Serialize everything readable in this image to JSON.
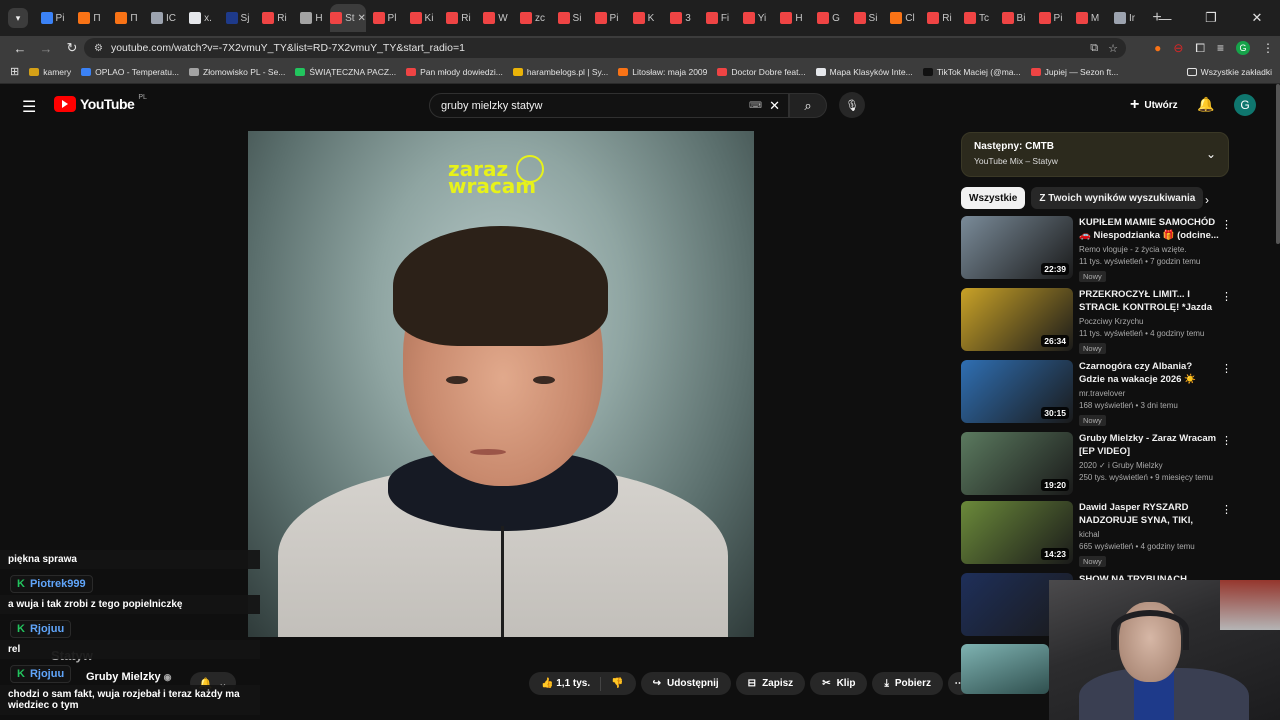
{
  "browser": {
    "tabs": [
      {
        "label": "Pi",
        "color": "#3b82f6"
      },
      {
        "label": "П",
        "color": "#f97316"
      },
      {
        "label": "П",
        "color": "#f97316"
      },
      {
        "label": "IC",
        "color": "#9ca3af"
      },
      {
        "label": "x.",
        "color": "#e5e7eb"
      },
      {
        "label": "Sj",
        "color": "#1e3a8a"
      },
      {
        "label": "Ri",
        "color": "#ef4444"
      },
      {
        "label": "H",
        "color": "#a3a3a3"
      },
      {
        "label": "St",
        "color": "#ef4444",
        "active": true
      },
      {
        "label": "Pl",
        "color": "#ef4444"
      },
      {
        "label": "Ki",
        "color": "#ef4444"
      },
      {
        "label": "Ri",
        "color": "#ef4444"
      },
      {
        "label": "W",
        "color": "#ef4444"
      },
      {
        "label": "zc",
        "color": "#ef4444"
      },
      {
        "label": "Si",
        "color": "#ef4444"
      },
      {
        "label": "Pi",
        "color": "#ef4444"
      },
      {
        "label": "K",
        "color": "#ef4444"
      },
      {
        "label": "3",
        "color": "#ef4444"
      },
      {
        "label": "Fi",
        "color": "#ef4444"
      },
      {
        "label": "Yi",
        "color": "#ef4444"
      },
      {
        "label": "H",
        "color": "#ef4444"
      },
      {
        "label": "G",
        "color": "#ef4444"
      },
      {
        "label": "Si",
        "color": "#ef4444"
      },
      {
        "label": "Cl",
        "color": "#f97316"
      },
      {
        "label": "Ri",
        "color": "#ef4444"
      },
      {
        "label": "Tc",
        "color": "#ef4444"
      },
      {
        "label": "Bi",
        "color": "#ef4444"
      },
      {
        "label": "Pi",
        "color": "#ef4444"
      },
      {
        "label": "M",
        "color": "#ef4444"
      },
      {
        "label": "Ir",
        "color": "#9ca3af"
      }
    ],
    "url": "youtube.com/watch?v=-7X2vmuY_TY&list=RD-7X2vmuY_TY&start_radio=1",
    "bookmarks": [
      {
        "label": "kamery",
        "color": "#d4a017"
      },
      {
        "label": "OPLAO - Temperatu...",
        "color": "#3b82f6"
      },
      {
        "label": "Złomowisko PL - Se...",
        "color": "#a3a3a3"
      },
      {
        "label": "ŚWIĄTECZNA PACZ...",
        "color": "#22c55e"
      },
      {
        "label": "Pan młody dowiedzi...",
        "color": "#ef4444"
      },
      {
        "label": "harambelogs.pl | Sy...",
        "color": "#eab308"
      },
      {
        "label": "Litosław: maja 2009",
        "color": "#f97316"
      },
      {
        "label": "Doctor Dobre feat...",
        "color": "#ef4444"
      },
      {
        "label": "Mapa Klasyków Inte...",
        "color": "#e5e7eb"
      },
      {
        "label": "TikTok Maciej (@ma...",
        "color": "#111111"
      },
      {
        "label": "Jupiej — Sezon ft...",
        "color": "#ef4444"
      }
    ],
    "bookmarks_all": "Wszystkie zakładki"
  },
  "youtube": {
    "logo_text": "YouTube",
    "region": "PL",
    "search_value": "gruby mielzky statyw",
    "create_label": "Utwórz",
    "avatar_letter": "G"
  },
  "video": {
    "overlay_text_line1": "zaraz",
    "overlay_text_line2": "wracam",
    "title": "Statyw",
    "channel": "Gruby Mielzky",
    "actions": {
      "likes": "1,1 tys.",
      "share": "Udostępnij",
      "save": "Zapisz",
      "clip": "Klip",
      "download": "Pobierz"
    }
  },
  "chat": [
    {
      "type": "msg",
      "text": "piękna sprawa"
    },
    {
      "type": "user",
      "name": "Piotrek999"
    },
    {
      "type": "msg",
      "text": "a wuja i tak zrobi z tego popielniczkę"
    },
    {
      "type": "user",
      "name": "Rjojuu"
    },
    {
      "type": "msg",
      "text": "rel"
    },
    {
      "type": "user",
      "name": "Rjojuu"
    },
    {
      "type": "msg",
      "text": "chodzi o sam fakt, wuja rozjebał i teraz każdy ma wiedziec o tym"
    }
  ],
  "sidebar": {
    "next_label": "Następny: CMTB",
    "next_sub": "YouTube Mix – Statyw",
    "chips": [
      "Wszystkie",
      "Z Twoich wyników wyszukiwania"
    ],
    "recommendations": [
      {
        "title": "KUPIŁEM MAMIE SAMOCHÓD 🚗 Niespodzianka 🎁 (odcine...",
        "channel": "Remo vloguje - z życia wzięte.",
        "meta": "11 tys. wyświetleń • 7 godzin temu",
        "duration": "22:39",
        "badge": "Nowy",
        "thumb": "#7a8b99"
      },
      {
        "title": "PRZEKROCZYŁ LIMIT... I STRACIŁ KONTROLĘ! *Jazda ...",
        "channel": "Poczciwy Krzychu",
        "meta": "11 tys. wyświetleń • 4 godziny temu",
        "duration": "26:34",
        "badge": "Nowy",
        "thumb": "#c9a227"
      },
      {
        "title": "Czarnogóra czy Albania? Gdzie na wakacje 2026 ☀️ Gdzie ...",
        "channel": "mr.travelover",
        "meta": "168 wyświetleń • 3 dni temu",
        "duration": "30:15",
        "badge": "Nowy",
        "thumb": "#2f6fb3"
      },
      {
        "title": "Gruby Mielzky - Zaraz Wracam [EP VIDEO]",
        "channel": "2020 ✓ i Gruby Mielzky",
        "meta": "250 tys. wyświetleń • 9 miesięcy temu",
        "duration": "19:20",
        "badge": "",
        "thumb": "#5b7a5f"
      },
      {
        "title": "Dawid Jasper RYSZARD NADZORUJE SYNA, TIKI, MIŚK...",
        "channel": "kichal",
        "meta": "665 wyświetleń • 4 godziny temu",
        "duration": "14:23",
        "badge": "Nowy",
        "thumb": "#6b8a3a"
      },
      {
        "title": "SHOW NA TRYBUNACH",
        "channel": "",
        "meta": "",
        "duration": "",
        "badge": "",
        "thumb": "#1e2f5a"
      }
    ]
  }
}
